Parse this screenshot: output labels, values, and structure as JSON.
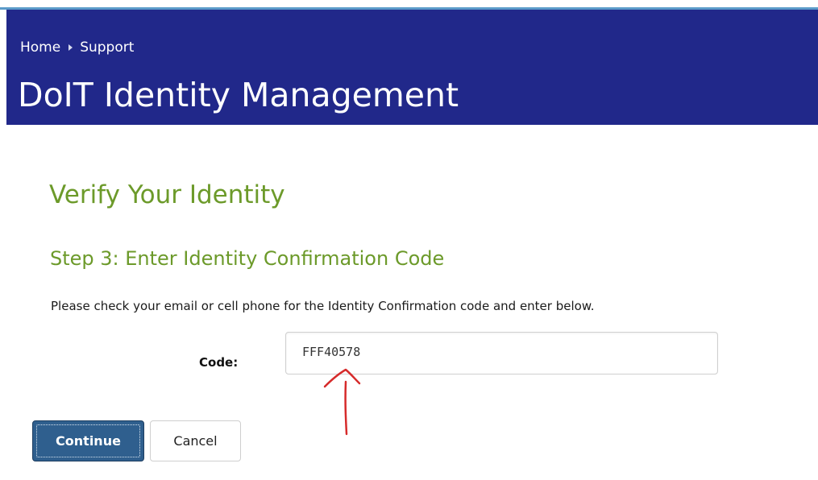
{
  "breadcrumb": {
    "home": "Home",
    "support": "Support"
  },
  "header": {
    "title": "DoIT Identity Management",
    "background": "#21288a"
  },
  "main": {
    "heading": "Verify Your Identity",
    "step_heading": "Step 3: Enter Identity Confirmation Code",
    "instructions": "Please check your email or cell phone for the Identity Confirmation code and enter below.",
    "heading_color": "#6c9a2a"
  },
  "form": {
    "code_label": "Code:",
    "code_value": "FFF40578"
  },
  "buttons": {
    "continue_label": "Continue",
    "cancel_label": "Cancel",
    "continue_color": "#2f5f8e"
  },
  "annotation": {
    "icon": "up-arrow-icon",
    "color": "#d62b2b"
  }
}
